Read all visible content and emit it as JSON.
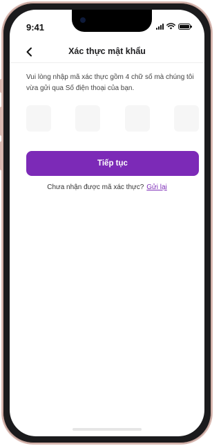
{
  "status_bar": {
    "time": "9:41",
    "icons": [
      "signal-icon",
      "wifi-icon",
      "battery-icon"
    ]
  },
  "header": {
    "back_icon": "chevron-left-icon",
    "title": "Xác thực mật khẩu"
  },
  "instruction": "Vui lòng nhập mã xác thực gồm 4 chữ số mà chúng tôi vừa gửi qua Số điện thoại của bạn.",
  "otp": {
    "digits": [
      "",
      "",
      "",
      ""
    ]
  },
  "continue_button": {
    "label": "Tiếp tục"
  },
  "resend": {
    "prompt": "Chưa nhận được mã xác thực?",
    "link": "Gửi lại"
  },
  "colors": {
    "accent": "#7c2ab7",
    "otp_box": "#f6f6f6",
    "frame": "#d9b9b2"
  }
}
